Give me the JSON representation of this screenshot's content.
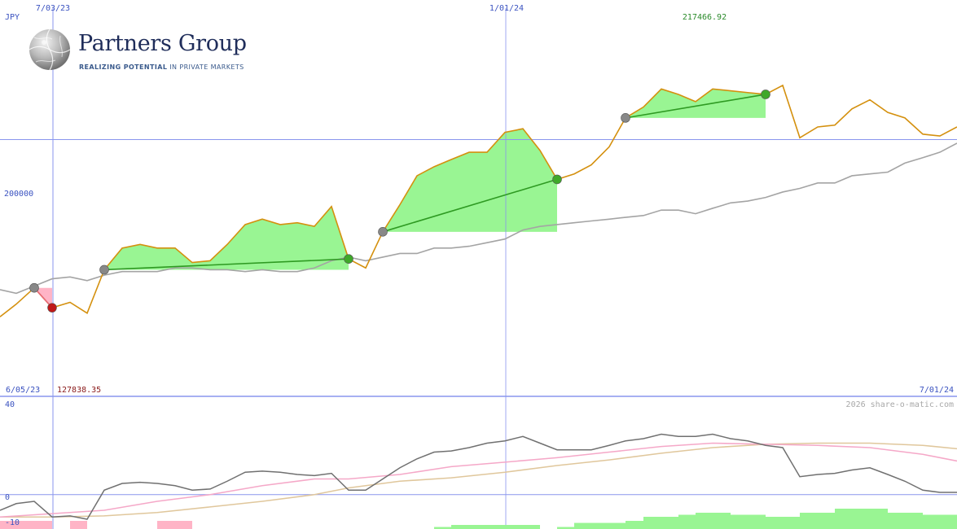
{
  "chart_data": [
    {
      "type": "line",
      "title": "",
      "currency_label": "JPY",
      "dates": {
        "start": "6/05/23",
        "marker1": "7/03/23",
        "marker2": "1/01/24",
        "end": "7/01/24"
      },
      "reference_level": 200000,
      "reference_label": "200000",
      "high_label": "217466.92",
      "low_label": "127838.35",
      "ylim": [
        129000,
        235000
      ],
      "series": [
        {
          "role": "price",
          "color": "#d4900e",
          "values": [
            [
              0,
              151000
            ],
            [
              20,
              154500
            ],
            [
              42,
              159000
            ],
            [
              64,
              153500
            ],
            [
              86,
              155000
            ],
            [
              107,
              152000
            ],
            [
              128,
              164000
            ],
            [
              150,
              170000
            ],
            [
              172,
              171000
            ],
            [
              193,
              170000
            ],
            [
              215,
              170000
            ],
            [
              236,
              166000
            ],
            [
              258,
              166500
            ],
            [
              279,
              171000
            ],
            [
              301,
              176500
            ],
            [
              322,
              178000
            ],
            [
              344,
              176500
            ],
            [
              365,
              177000
            ],
            [
              386,
              176000
            ],
            [
              407,
              181500
            ],
            [
              428,
              167000
            ],
            [
              449,
              164500
            ],
            [
              470,
              174500
            ],
            [
              491,
              182000
            ],
            [
              512,
              190000
            ],
            [
              533,
              192500
            ],
            [
              554,
              194500
            ],
            [
              576,
              196500
            ],
            [
              598,
              196500
            ],
            [
              620,
              202000
            ],
            [
              642,
              203000
            ],
            [
              663,
              197000
            ],
            [
              684,
              189000
            ],
            [
              705,
              190500
            ],
            [
              726,
              193000
            ],
            [
              748,
              198000
            ],
            [
              768,
              206000
            ],
            [
              790,
              209000
            ],
            [
              812,
              214000
            ],
            [
              833,
              212500
            ],
            [
              854,
              210500
            ],
            [
              875,
              214000
            ],
            [
              897,
              213500
            ],
            [
              918,
              213000
            ],
            [
              940,
              212500
            ],
            [
              961,
              215000
            ],
            [
              982,
              200500
            ],
            [
              1004,
              203500
            ],
            [
              1025,
              204000
            ],
            [
              1046,
              208500
            ],
            [
              1068,
              211000
            ],
            [
              1090,
              207500
            ],
            [
              1111,
              206000
            ],
            [
              1133,
              201500
            ],
            [
              1154,
              201000
            ],
            [
              1175,
              203500
            ]
          ]
        },
        {
          "role": "moving-average",
          "color": "#a4a4a4",
          "values": [
            [
              0,
              158500
            ],
            [
              20,
              157500
            ],
            [
              42,
              159500
            ],
            [
              64,
              161500
            ],
            [
              86,
              162000
            ],
            [
              107,
              161000
            ],
            [
              128,
              162500
            ],
            [
              150,
              163500
            ],
            [
              172,
              163500
            ],
            [
              193,
              163500
            ],
            [
              215,
              164500
            ],
            [
              236,
              164500
            ],
            [
              258,
              164000
            ],
            [
              279,
              164000
            ],
            [
              301,
              163500
            ],
            [
              322,
              164000
            ],
            [
              344,
              163500
            ],
            [
              365,
              163500
            ],
            [
              386,
              164500
            ],
            [
              407,
              166500
            ],
            [
              428,
              167500
            ],
            [
              449,
              166500
            ],
            [
              470,
              167500
            ],
            [
              491,
              168500
            ],
            [
              512,
              168500
            ],
            [
              533,
              170000
            ],
            [
              554,
              170000
            ],
            [
              576,
              170500
            ],
            [
              598,
              171500
            ],
            [
              620,
              172500
            ],
            [
              642,
              175000
            ],
            [
              663,
              176000
            ],
            [
              684,
              176500
            ],
            [
              705,
              177000
            ],
            [
              726,
              177500
            ],
            [
              748,
              178000
            ],
            [
              768,
              178500
            ],
            [
              790,
              179000
            ],
            [
              812,
              180500
            ],
            [
              833,
              180500
            ],
            [
              854,
              179500
            ],
            [
              875,
              181000
            ],
            [
              897,
              182500
            ],
            [
              918,
              183000
            ],
            [
              940,
              184000
            ],
            [
              961,
              185500
            ],
            [
              982,
              186500
            ],
            [
              1004,
              188000
            ],
            [
              1025,
              188000
            ],
            [
              1046,
              190000
            ],
            [
              1068,
              190500
            ],
            [
              1090,
              191000
            ],
            [
              1111,
              193500
            ],
            [
              1133,
              195000
            ],
            [
              1154,
              196500
            ],
            [
              1175,
              199000
            ]
          ]
        }
      ],
      "signals": [
        {
          "x": 42,
          "value": 159000,
          "color": "#888888"
        },
        {
          "x": 64,
          "value": 153500,
          "color": "#c01818"
        },
        {
          "x": 128,
          "value": 164000,
          "color": "#888888"
        },
        {
          "x": 428,
          "value": 167000,
          "color": "#3fa82a"
        },
        {
          "x": 470,
          "value": 174500,
          "color": "#888888"
        },
        {
          "x": 684,
          "value": 189000,
          "color": "#3fa82a"
        },
        {
          "x": 768,
          "value": 206000,
          "color": "#888888"
        },
        {
          "x": 940,
          "value": 212500,
          "color": "#3fa82a"
        }
      ],
      "trades": [
        {
          "from": 42,
          "to": 64,
          "outcome": "loss"
        },
        {
          "from": 128,
          "to": 428,
          "outcome": "gain"
        },
        {
          "from": 470,
          "to": 684,
          "outcome": "gain"
        },
        {
          "from": 768,
          "to": 940,
          "outcome": "gain"
        }
      ],
      "colors": {
        "gain_fill": "#99f593",
        "loss_fill": "#ffb4c6",
        "gain_line": "#2e9a22",
        "loss_line": "#e86a7a",
        "axis_text": "#3a52c0",
        "gridline": "#8a96ee",
        "high_text": "#2a8a2a",
        "low_text": "#8a1a1a"
      }
    },
    {
      "type": "line",
      "title": "",
      "watermark": "2026 share-o-matic.com",
      "ylim": [
        -11,
        41
      ],
      "ticks": [
        {
          "value": 40,
          "label": "40"
        },
        {
          "value": 0,
          "label": "0"
        },
        {
          "value": -10,
          "label": "-10"
        }
      ],
      "series": [
        {
          "role": "oscillator",
          "color": "#707070",
          "values": [
            [
              0,
              -7
            ],
            [
              20,
              -4
            ],
            [
              42,
              -3
            ],
            [
              64,
              -10
            ],
            [
              86,
              -9.5
            ],
            [
              107,
              -11
            ],
            [
              128,
              2
            ],
            [
              150,
              5
            ],
            [
              172,
              5.5
            ],
            [
              193,
              5
            ],
            [
              215,
              4
            ],
            [
              236,
              2
            ],
            [
              258,
              2.5
            ],
            [
              279,
              6
            ],
            [
              301,
              10
            ],
            [
              322,
              10.5
            ],
            [
              344,
              10
            ],
            [
              365,
              9
            ],
            [
              386,
              8.5
            ],
            [
              407,
              9.5
            ],
            [
              428,
              2
            ],
            [
              449,
              2
            ],
            [
              470,
              7
            ],
            [
              491,
              12
            ],
            [
              512,
              16
            ],
            [
              533,
              19
            ],
            [
              554,
              19.5
            ],
            [
              576,
              21
            ],
            [
              598,
              23
            ],
            [
              620,
              24
            ],
            [
              642,
              26
            ],
            [
              663,
              23
            ],
            [
              684,
              20
            ],
            [
              705,
              20
            ],
            [
              726,
              20
            ],
            [
              748,
              22
            ],
            [
              768,
              24
            ],
            [
              790,
              25
            ],
            [
              812,
              27
            ],
            [
              833,
              26
            ],
            [
              854,
              26
            ],
            [
              875,
              27
            ],
            [
              897,
              25
            ],
            [
              918,
              24
            ],
            [
              940,
              22
            ],
            [
              961,
              21
            ],
            [
              982,
              8
            ],
            [
              1004,
              9
            ],
            [
              1025,
              9.5
            ],
            [
              1046,
              11
            ],
            [
              1068,
              12
            ],
            [
              1090,
              9
            ],
            [
              1111,
              6
            ],
            [
              1133,
              2
            ],
            [
              1154,
              1
            ],
            [
              1175,
              1
            ]
          ]
        },
        {
          "role": "signal-fast",
          "color": "#f5a8c8",
          "values": [
            [
              0,
              -10
            ],
            [
              64,
              -8.5
            ],
            [
              128,
              -7
            ],
            [
              193,
              -3
            ],
            [
              258,
              0
            ],
            [
              322,
              4
            ],
            [
              386,
              7
            ],
            [
              428,
              7
            ],
            [
              491,
              9
            ],
            [
              554,
              12.5
            ],
            [
              620,
              14.5
            ],
            [
              684,
              16.5
            ],
            [
              748,
              19
            ],
            [
              812,
              21.5
            ],
            [
              875,
              23
            ],
            [
              940,
              22.5
            ],
            [
              1004,
              22
            ],
            [
              1068,
              21
            ],
            [
              1133,
              18
            ],
            [
              1175,
              15
            ]
          ]
        },
        {
          "role": "signal-slow",
          "color": "#e0c79c",
          "values": [
            [
              0,
              -10
            ],
            [
              64,
              -10
            ],
            [
              128,
              -9.5
            ],
            [
              193,
              -8
            ],
            [
              258,
              -5.5
            ],
            [
              322,
              -3
            ],
            [
              386,
              0
            ],
            [
              428,
              3
            ],
            [
              491,
              6
            ],
            [
              554,
              7.5
            ],
            [
              620,
              10
            ],
            [
              684,
              13
            ],
            [
              748,
              15.5
            ],
            [
              812,
              18.5
            ],
            [
              875,
              21
            ],
            [
              940,
              22.5
            ],
            [
              1004,
              23
            ],
            [
              1068,
              23
            ],
            [
              1133,
              22
            ],
            [
              1175,
              20.5
            ]
          ]
        }
      ],
      "histogram": [
        {
          "x0": 0,
          "x1": 64,
          "value": -2,
          "color": "#ffb4c6"
        },
        {
          "x0": 86,
          "x1": 107,
          "value": -2,
          "color": "#ffb4c6"
        },
        {
          "x0": 193,
          "x1": 236,
          "value": -2,
          "color": "#ffb4c6"
        },
        {
          "x0": 533,
          "x1": 554,
          "value": 0.5,
          "color": "#99f593"
        },
        {
          "x0": 554,
          "x1": 663,
          "value": 1,
          "color": "#99f593"
        },
        {
          "x0": 684,
          "x1": 705,
          "value": 0.5,
          "color": "#99f593"
        },
        {
          "x0": 705,
          "x1": 768,
          "value": 1.5,
          "color": "#99f593"
        },
        {
          "x0": 768,
          "x1": 790,
          "value": 2,
          "color": "#99f593"
        },
        {
          "x0": 790,
          "x1": 833,
          "value": 3,
          "color": "#99f593"
        },
        {
          "x0": 833,
          "x1": 854,
          "value": 3.5,
          "color": "#99f593"
        },
        {
          "x0": 854,
          "x1": 897,
          "value": 4,
          "color": "#99f593"
        },
        {
          "x0": 897,
          "x1": 940,
          "value": 3.5,
          "color": "#99f593"
        },
        {
          "x0": 940,
          "x1": 982,
          "value": 3,
          "color": "#99f593"
        },
        {
          "x0": 982,
          "x1": 1025,
          "value": 4,
          "color": "#99f593"
        },
        {
          "x0": 1025,
          "x1": 1090,
          "value": 5,
          "color": "#99f593"
        },
        {
          "x0": 1090,
          "x1": 1133,
          "value": 4,
          "color": "#99f593"
        },
        {
          "x0": 1133,
          "x1": 1175,
          "value": 3.5,
          "color": "#99f593"
        }
      ]
    }
  ],
  "logo": {
    "name": "Partners Group",
    "tagline_bold": "REALIZING POTENTIAL",
    "tagline_rest": " IN PRIVATE MARKETS",
    "icon": "puzzle-globe-icon"
  }
}
